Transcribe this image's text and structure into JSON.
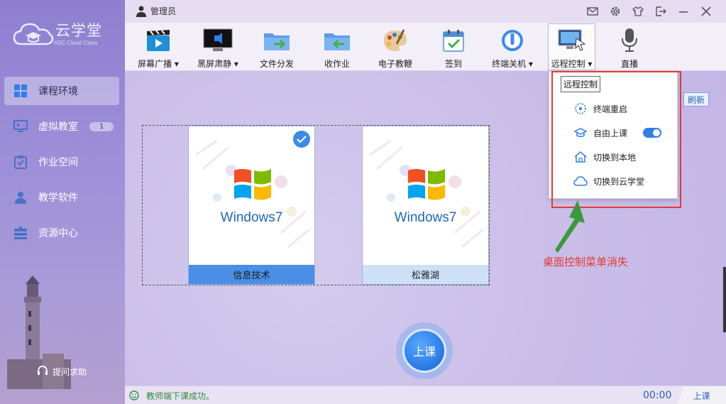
{
  "app": {
    "logo_title": "云学堂",
    "logo_subtitle": "H3C Cloud Class",
    "user_label": "管理员"
  },
  "sidebar": {
    "items": [
      {
        "label": "课程环境",
        "active": true
      },
      {
        "label": "虚拟教室",
        "badge": "1"
      },
      {
        "label": "作业空间"
      },
      {
        "label": "教学软件"
      },
      {
        "label": "资源中心"
      }
    ],
    "help_label": "提问求助"
  },
  "toolbar": {
    "items": [
      {
        "label": "屏幕广播",
        "has_menu": true,
        "icon": "clapperboard-icon"
      },
      {
        "label": "黑屏肃静",
        "has_menu": true,
        "icon": "black-monitor-icon"
      },
      {
        "label": "文件分发",
        "icon": "folder-send-icon"
      },
      {
        "label": "收作业",
        "icon": "folder-receive-icon"
      },
      {
        "label": "电子教鞭",
        "icon": "palette-icon"
      },
      {
        "label": "签到",
        "icon": "calendar-check-icon"
      },
      {
        "label": "终端关机",
        "has_menu": true,
        "icon": "power-icon"
      },
      {
        "label": "远程控制",
        "has_menu": true,
        "icon": "remote-desktop-icon",
        "selected": true
      },
      {
        "label": "直播",
        "icon": "microphone-icon"
      }
    ],
    "menu_arrow": "▾"
  },
  "main": {
    "refresh_label": "刷新",
    "cards": [
      {
        "caption": "信息技术",
        "os_label": "Windows7",
        "selected": true
      },
      {
        "caption": "松雅湖",
        "os_label": "Windows7",
        "selected": false
      }
    ],
    "start_button": "上课"
  },
  "dropdown": {
    "header": "远程控制",
    "items": [
      {
        "label": "终端重启",
        "icon": "restart-icon"
      },
      {
        "label": "自由上课",
        "icon": "graduation-cap-icon",
        "toggle": true
      },
      {
        "label": "切换到本地",
        "icon": "home-icon"
      },
      {
        "label": "切换到云学堂",
        "icon": "cloud-icon"
      }
    ]
  },
  "annotation": {
    "text": "桌面控制菜单消失",
    "color": "#e53935"
  },
  "status": {
    "message": "教师端下课成功。",
    "timer": "00:00",
    "right_label": "上课"
  },
  "colors": {
    "accent_blue": "#2f7fe8",
    "selected_card_caption": "#4a8fe7",
    "status_green": "#2e8b3d"
  }
}
